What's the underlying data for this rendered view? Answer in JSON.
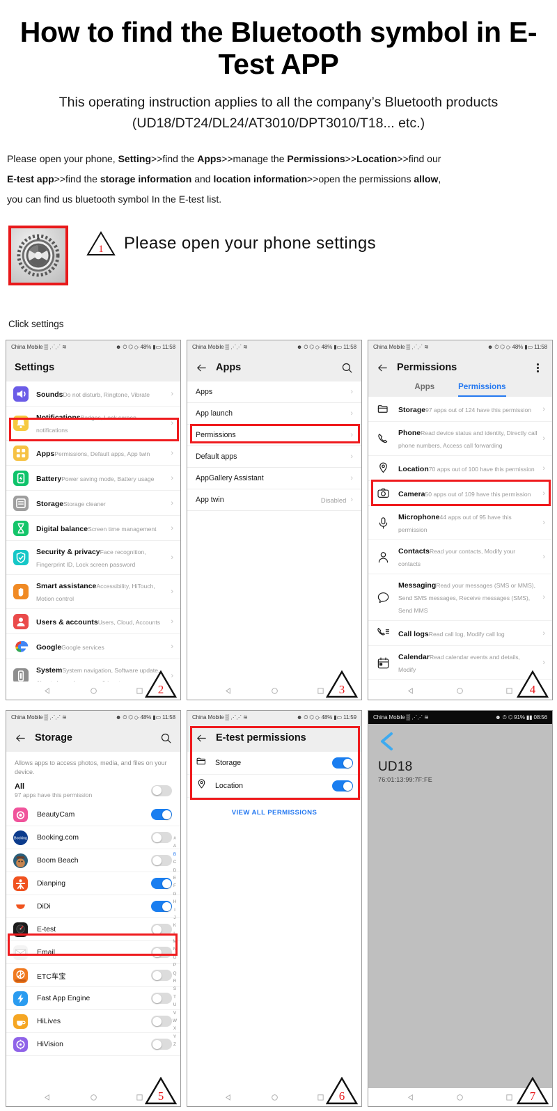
{
  "hero": {
    "title": "How to find the Bluetooth symbol in E-Test APP",
    "subtitle_line1": "This operating instruction applies to all the company’s Bluetooth products",
    "subtitle_line2": "(UD18/DT24/DL24/AT3010/DPT3010/T18... etc.)"
  },
  "instructions": {
    "l1a": "Please open your phone, ",
    "l1b": "Setting",
    "l1c": ">>find the ",
    "l1d": "Apps",
    "l1e": ">>manage the ",
    "l1f": "Permissions",
    "l1g": ">>",
    "l1h": "Location",
    "l1i": ">>find our",
    "l2a": "E-test app",
    "l2b": ">>find the ",
    "l2c": "storage information",
    "l2d": " and ",
    "l2e": "location information",
    "l2f": ">>open the permissions ",
    "l2g": "allow",
    "l2h": ",",
    "l3": "you can find us bluetooth symbol In the E-test list."
  },
  "step1": {
    "badge": "1",
    "text": "Please open your phone settings",
    "caption": "Click settings"
  },
  "statusbars": {
    "carrier": "China Mobile",
    "battery": "48%",
    "time_1158": "11:58",
    "time_1159": "11:59",
    "battery_91": "91%",
    "time_0856": "08:56"
  },
  "panel2": {
    "badge": "2",
    "title": "Settings",
    "rows": [
      {
        "title": "Sounds",
        "sub": "Do not disturb, Ringtone, Vibrate",
        "icon": "sound-icon",
        "color": "#6b5ce7"
      },
      {
        "title": "Notifications",
        "sub": "Badges, Lock screen notifications",
        "icon": "bell-icon",
        "color": "#fac games"
      },
      {
        "title": "Apps",
        "sub": "Permissions, Default apps, App twin",
        "icon": "apps-icon",
        "color": "#f6c244"
      },
      {
        "title": "Battery",
        "sub": "Power saving mode, Battery usage",
        "icon": "battery-icon",
        "color": "#0ec36a"
      },
      {
        "title": "Storage",
        "sub": "Storage cleaner",
        "icon": "storage-icon",
        "color": "#9e9e9e"
      },
      {
        "title": "Digital balance",
        "sub": "Screen time management",
        "icon": "hourglass-icon",
        "color": "#14c56a"
      },
      {
        "title": "Security & privacy",
        "sub": "Face recognition, Fingerprint ID, Lock screen password",
        "icon": "shield-icon",
        "color": "#16c7c7"
      },
      {
        "title": "Smart assistance",
        "sub": "Accessibility, HiTouch, Motion control",
        "icon": "hand-icon",
        "color": "#f08a24"
      },
      {
        "title": "Users & accounts",
        "sub": "Users, Cloud, Accounts",
        "icon": "user-icon",
        "color": "#ea4b4b"
      },
      {
        "title": "Google",
        "sub": "Google services",
        "icon": "google-icon",
        "color": "#ffffff"
      },
      {
        "title": "System",
        "sub": "System navigation, Software update, About phone, Language & input",
        "icon": "system-icon",
        "color": "#8e8e8e"
      }
    ]
  },
  "panel3": {
    "badge": "3",
    "title": "Apps",
    "rows": [
      {
        "label": "Apps",
        "trail": ""
      },
      {
        "label": "App launch",
        "trail": ""
      },
      {
        "label": "Permissions",
        "trail": ""
      },
      {
        "label": "Default apps",
        "trail": ""
      },
      {
        "label": "AppGallery Assistant",
        "trail": ""
      },
      {
        "label": "App twin",
        "trail": "Disabled"
      }
    ]
  },
  "panel4": {
    "badge": "4",
    "title": "Permissions",
    "tabs": [
      {
        "label": "Apps",
        "active": false
      },
      {
        "label": "Permissions",
        "active": true
      }
    ],
    "rows": [
      {
        "title": "Storage",
        "sub": "97 apps out of 124 have this permission",
        "icon": "folder-icon"
      },
      {
        "title": "Phone",
        "sub": "Read device status and identity, Directly call phone numbers, Access call forwarding",
        "icon": "phone-icon"
      },
      {
        "title": "Location",
        "sub": "70 apps out of 100 have this permission",
        "icon": "location-pin-icon"
      },
      {
        "title": "Camera",
        "sub": "50 apps out of 109 have this permission",
        "icon": "camera-icon"
      },
      {
        "title": "Microphone",
        "sub": "44 apps out of 95 have this permission",
        "icon": "microphone-icon"
      },
      {
        "title": "Contacts",
        "sub": "Read your contacts, Modify your contacts",
        "icon": "contact-icon"
      },
      {
        "title": "Messaging",
        "sub": "Read your messages (SMS or MMS), Send SMS messages, Receive messages (SMS), Send MMS",
        "icon": "message-icon"
      },
      {
        "title": "Call logs",
        "sub": "Read call log, Modify call log",
        "icon": "call-log-icon"
      },
      {
        "title": "Calendar",
        "sub": "Read calendar events and details, Modify",
        "icon": "calendar-icon"
      }
    ]
  },
  "panel5": {
    "badge": "5",
    "title": "Storage",
    "description": "Allows apps to access photos, media, and files on your device.",
    "all_label": "All",
    "all_sub": "97 apps have this permission",
    "all_on": false,
    "apps": [
      {
        "name": "BeautyCam",
        "on": true,
        "color": "#f0539b"
      },
      {
        "name": "Booking.com",
        "on": false,
        "color": "#0b3b8c"
      },
      {
        "name": "Boom Beach",
        "on": false,
        "color": "#8c5a3c"
      },
      {
        "name": "Dianping",
        "on": true,
        "color": "#f0521f"
      },
      {
        "name": "DiDi",
        "on": true,
        "color": "#ffffff"
      },
      {
        "name": "E-test",
        "on": false,
        "color": "#1c1c1c"
      },
      {
        "name": "Email",
        "on": false,
        "color": "#f2f2f2"
      },
      {
        "name": "ETC车宝",
        "on": false,
        "color": "#f07a20"
      },
      {
        "name": "Fast App Engine",
        "on": false,
        "color": "#2b9cf0"
      },
      {
        "name": "HiLives",
        "on": false,
        "color": "#f5a623"
      },
      {
        "name": "HiVision",
        "on": false,
        "color": "#8f63e8"
      }
    ],
    "alphabet": [
      "#",
      "A",
      "B",
      "C",
      "D",
      "E",
      "F",
      "G",
      "H",
      "I",
      "J",
      "K",
      "L",
      "M",
      "N",
      "O",
      "P",
      "Q",
      "R",
      "S",
      "T",
      "U",
      "V",
      "W",
      "X",
      "Y",
      "Z"
    ],
    "alphabet_active": "B"
  },
  "panel6": {
    "badge": "6",
    "title": "E-test permissions",
    "rows": [
      {
        "label": "Storage",
        "on": true,
        "icon": "folder-icon"
      },
      {
        "label": "Location",
        "on": true,
        "icon": "location-pin-icon"
      }
    ],
    "view_all": "VIEW ALL PERMISSIONS"
  },
  "panel7": {
    "badge": "7",
    "device_name": "UD18",
    "device_mac": "76:01:13:99:7F:FE"
  },
  "colors": {
    "accent_red": "#ef1b1e",
    "accent_blue": "#2478f0"
  }
}
